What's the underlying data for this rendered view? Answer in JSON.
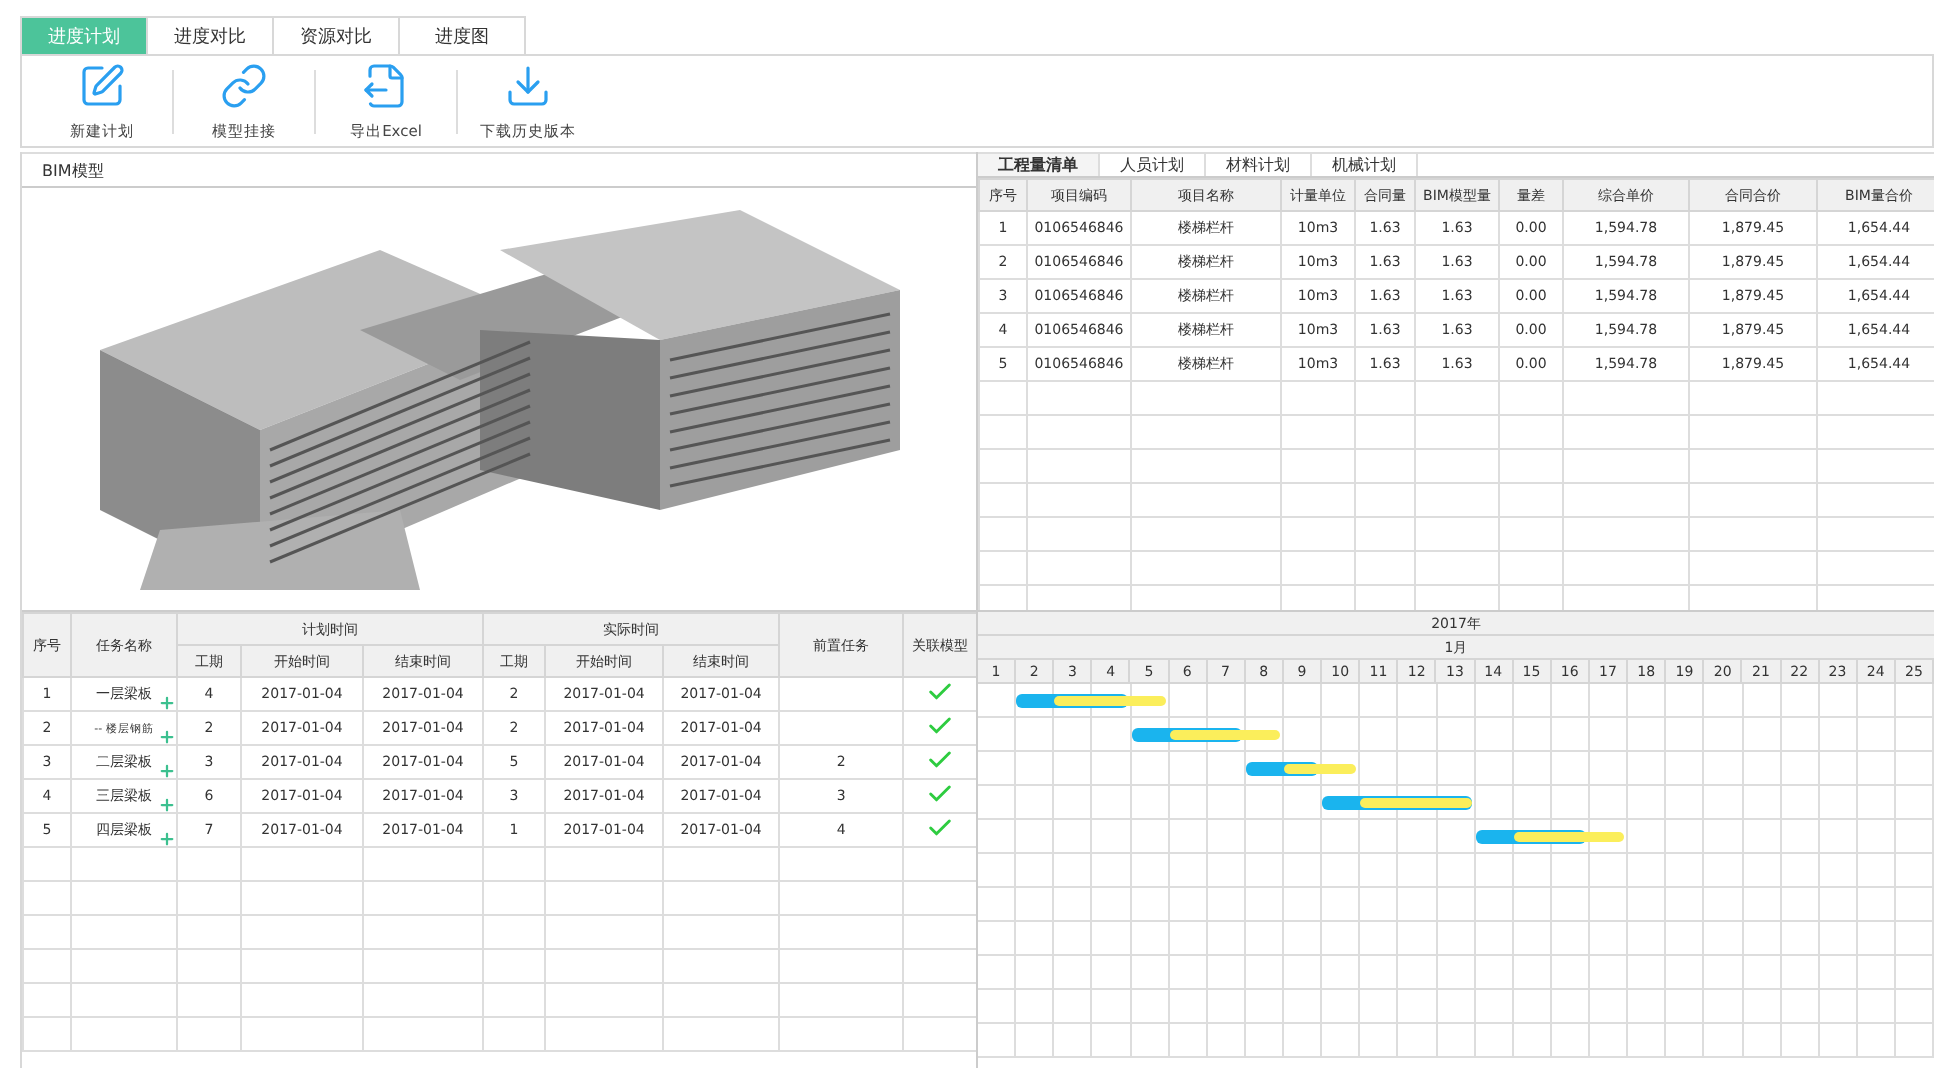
{
  "tabs": [
    {
      "label": "进度计划",
      "selected": true
    },
    {
      "label": "进度对比",
      "selected": false
    },
    {
      "label": "资源对比",
      "selected": false
    },
    {
      "label": "进度图",
      "selected": false
    }
  ],
  "toolbar": [
    {
      "kind": "new",
      "label": "新建计划"
    },
    {
      "kind": "link",
      "label": "模型挂接"
    },
    {
      "kind": "export",
      "label": "导出Excel"
    },
    {
      "kind": "download",
      "label": "下载历史版本"
    }
  ],
  "model_panel": {
    "title": "BIM模型"
  },
  "resource_tabs": [
    {
      "label": "工程量清单",
      "selected": true
    },
    {
      "label": "人员计划",
      "selected": false
    },
    {
      "label": "材料计划",
      "selected": false
    },
    {
      "label": "机械计划",
      "selected": false
    }
  ],
  "quantity_table": {
    "columns": [
      "序号",
      "项目编码",
      "项目名称",
      "计量单位",
      "合同量",
      "BIM模型量",
      "量差",
      "综合单价",
      "合同合价",
      "BIM量合价"
    ],
    "rows": [
      [
        "1",
        "0106546846",
        "楼梯栏杆",
        "10m3",
        "1.63",
        "1.63",
        "0.00",
        "1,594.78",
        "1,879.45",
        "1,654.44"
      ],
      [
        "2",
        "0106546846",
        "楼梯栏杆",
        "10m3",
        "1.63",
        "1.63",
        "0.00",
        "1,594.78",
        "1,879.45",
        "1,654.44"
      ],
      [
        "3",
        "0106546846",
        "楼梯栏杆",
        "10m3",
        "1.63",
        "1.63",
        "0.00",
        "1,594.78",
        "1,879.45",
        "1,654.44"
      ],
      [
        "4",
        "0106546846",
        "楼梯栏杆",
        "10m3",
        "1.63",
        "1.63",
        "0.00",
        "1,594.78",
        "1,879.45",
        "1,654.44"
      ],
      [
        "5",
        "0106546846",
        "楼梯栏杆",
        "10m3",
        "1.63",
        "1.63",
        "0.00",
        "1,594.78",
        "1,879.45",
        "1,654.44"
      ]
    ]
  },
  "plan_table": {
    "columns": {
      "index": "序号",
      "task": "任务名称",
      "planned": "计划时间",
      "actual": "实际时间",
      "plan_duration": "工期",
      "plan_start": "开始时间",
      "plan_end": "结束时间",
      "actual_duration": "工期",
      "actual_start": "开始时间",
      "actual_end": "结束时间",
      "predecessor": "前置任务",
      "linked_model": "关联模型"
    },
    "rows": [
      {
        "index": "1",
        "task": "一层梁板",
        "plan_duration": "4",
        "plan_start": "2017-01-04",
        "plan_end": "2017-01-04",
        "actual_duration": "2",
        "actual_start": "2017-01-04",
        "actual_end": "2017-01-04",
        "linked": true
      },
      {
        "index": "2",
        "task": "-- 楼层钢筋",
        "plan_duration": "2",
        "plan_start": "2017-01-04",
        "plan_end": "2017-01-04",
        "actual_duration": "2",
        "actual_start": "2017-01-04",
        "actual_end": "2017-01-04",
        "linked": true
      },
      {
        "index": "3",
        "task": "二层梁板",
        "plan_duration": "3",
        "plan_start": "2017-01-04",
        "plan_end": "2017-01-04",
        "actual_duration": "5",
        "actual_start": "2017-01-04",
        "actual_end": "2017-01-04",
        "predecessor": "2",
        "linked": true
      },
      {
        "index": "4",
        "task": "三层梁板",
        "plan_duration": "6",
        "plan_start": "2017-01-04",
        "plan_end": "2017-01-04",
        "actual_duration": "3",
        "actual_start": "2017-01-04",
        "actual_end": "2017-01-04",
        "predecessor": "3",
        "linked": true
      },
      {
        "index": "5",
        "task": "四层梁板",
        "plan_duration": "7",
        "plan_start": "2017-01-04",
        "plan_end": "2017-01-04",
        "actual_duration": "1",
        "actual_start": "2017-01-04",
        "actual_end": "2017-01-04",
        "predecessor": "4",
        "linked": true
      }
    ]
  },
  "gantt": {
    "year": "2017年",
    "month": "1月",
    "days": [
      "1",
      "2",
      "3",
      "4",
      "5",
      "6",
      "7",
      "8",
      "9",
      "10",
      "11",
      "12",
      "13",
      "14",
      "15",
      "16",
      "17",
      "18",
      "19",
      "20",
      "21",
      "22",
      "23",
      "24",
      "25"
    ],
    "bars": [
      {
        "plan": [
          false,
          true,
          true,
          true,
          false,
          false,
          false,
          false,
          false,
          false,
          false,
          false,
          false,
          false,
          false,
          false,
          false,
          false,
          false,
          false,
          false,
          false,
          false,
          false,
          false
        ],
        "actual": [
          false,
          false,
          true,
          true,
          true,
          false,
          false,
          false,
          false,
          false,
          false,
          false,
          false,
          false,
          false,
          false,
          false,
          false,
          false,
          false,
          false,
          false,
          false,
          false,
          false
        ]
      },
      {
        "plan": [
          false,
          false,
          false,
          false,
          true,
          true,
          true,
          false,
          false,
          false,
          false,
          false,
          false,
          false,
          false,
          false,
          false,
          false,
          false,
          false,
          false,
          false,
          false,
          false,
          false
        ],
        "actual": [
          false,
          false,
          false,
          false,
          false,
          true,
          true,
          true,
          false,
          false,
          false,
          false,
          false,
          false,
          false,
          false,
          false,
          false,
          false,
          false,
          false,
          false,
          false,
          false,
          false
        ]
      },
      {
        "plan": [
          false,
          false,
          false,
          false,
          false,
          false,
          false,
          true,
          true,
          false,
          false,
          false,
          false,
          false,
          false,
          false,
          false,
          false,
          false,
          false,
          false,
          false,
          false,
          false,
          false
        ],
        "actual": [
          false,
          false,
          false,
          false,
          false,
          false,
          false,
          false,
          true,
          true,
          false,
          false,
          false,
          false,
          false,
          false,
          false,
          false,
          false,
          false,
          false,
          false,
          false,
          false,
          false
        ]
      },
      {
        "plan": [
          false,
          false,
          false,
          false,
          false,
          false,
          false,
          false,
          false,
          true,
          true,
          true,
          true,
          false,
          false,
          false,
          false,
          false,
          false,
          false,
          false,
          false,
          false,
          false,
          false
        ],
        "actual": [
          false,
          false,
          false,
          false,
          false,
          false,
          false,
          false,
          false,
          false,
          true,
          true,
          true,
          false,
          false,
          false,
          false,
          false,
          false,
          false,
          false,
          false,
          false,
          false,
          false
        ]
      },
      {
        "plan": [
          false,
          false,
          false,
          false,
          false,
          false,
          false,
          false,
          false,
          false,
          false,
          false,
          false,
          true,
          true,
          true,
          false,
          false,
          false,
          false,
          false,
          false,
          false,
          false,
          false
        ],
        "actual": [
          false,
          false,
          false,
          false,
          false,
          false,
          false,
          false,
          false,
          false,
          false,
          false,
          false,
          false,
          true,
          true,
          true,
          false,
          false,
          false,
          false,
          false,
          false,
          false,
          false
        ]
      }
    ]
  }
}
